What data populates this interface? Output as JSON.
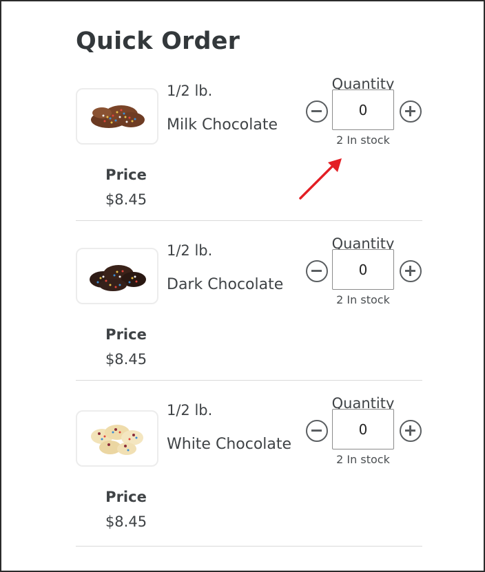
{
  "page": {
    "title": "Quick Order"
  },
  "colors": {
    "accent_arrow": "#e31e24",
    "text": "#3f4346",
    "border": "#2b2b2b"
  },
  "products": [
    {
      "size": "1/2 lb.",
      "name": "Milk Chocolate",
      "price_label": "Price",
      "price": "$8.45",
      "quantity_label": "Quantity",
      "quantity": "0",
      "stock": "2 In stock",
      "image": "milk-chocolate-nonpareils"
    },
    {
      "size": "1/2 lb.",
      "name": "Dark Chocolate",
      "price_label": "Price",
      "price": "$8.45",
      "quantity_label": "Quantity",
      "quantity": "0",
      "stock": "2 In stock",
      "image": "dark-chocolate-nonpareils"
    },
    {
      "size": "1/2 lb.",
      "name": "White Chocolate",
      "price_label": "Price",
      "price": "$8.45",
      "quantity_label": "Quantity",
      "quantity": "0",
      "stock": "2 In stock",
      "image": "white-chocolate-nonpareils"
    }
  ],
  "icons": {
    "decrement": "minus-circle-icon",
    "increment": "plus-circle-icon",
    "annotation": "red-arrow"
  }
}
